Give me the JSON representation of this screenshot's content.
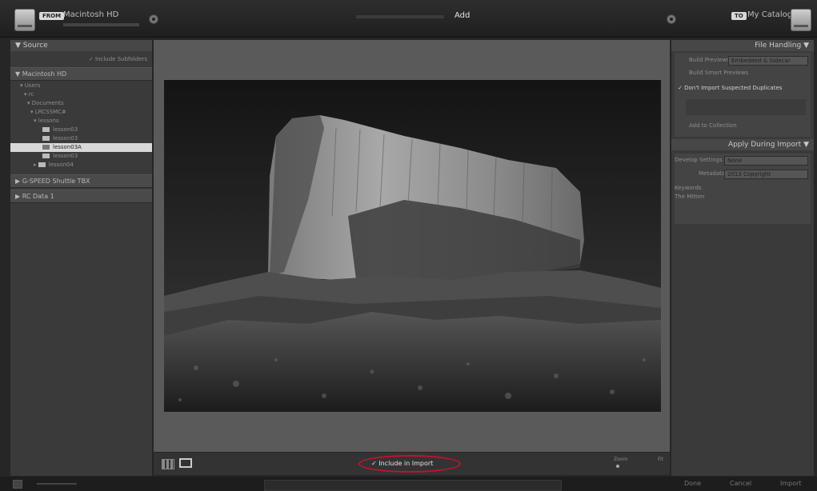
{
  "header": {
    "from_badge": "FROM",
    "source_name": "Macintosh HD",
    "mode": "Add",
    "to_badge": "TO",
    "destination": "My Catalog"
  },
  "left_panel": {
    "title": "Source",
    "include_subfolders": "Include Subfolders",
    "volumes": [
      "Macintosh HD",
      "G-SPEED Shuttle TBX",
      "RC Data 1"
    ],
    "tree": [
      {
        "label": "Users"
      },
      {
        "label": "rc"
      },
      {
        "label": "Documents"
      },
      {
        "label": "LRCSSMC#"
      },
      {
        "label": "lessons"
      },
      {
        "label": "lesson03"
      },
      {
        "label": "lesson03"
      },
      {
        "label": "lesson03A"
      },
      {
        "label": "lesson03"
      },
      {
        "label": "lesson04"
      }
    ]
  },
  "right_panel": {
    "file_handling": "File Handling",
    "build_previews_label": "Build Previews",
    "build_previews_value": "Embedded & Sidecar",
    "smart_previews": "Build Smart Previews",
    "dont_import_duplicates": "Don't Import Suspected Duplicates",
    "add_to_collection": "Add to Collection",
    "apply_during_import": "Apply During Import",
    "develop_settings_label": "Develop Settings",
    "develop_settings_value": "None",
    "metadata_label": "Metadata",
    "metadata_value": "2013 Copyright",
    "keywords_label": "Keywords",
    "keywords_value": "The Mitten"
  },
  "toolbar": {
    "include_in_import": "Include in Import",
    "zoom_label": "Zoom",
    "fit_label": "Fit"
  },
  "bottom": {
    "done": "Done",
    "cancel": "Cancel",
    "import": "Import"
  },
  "colors": {
    "highlight_circle": "#c8102e"
  }
}
